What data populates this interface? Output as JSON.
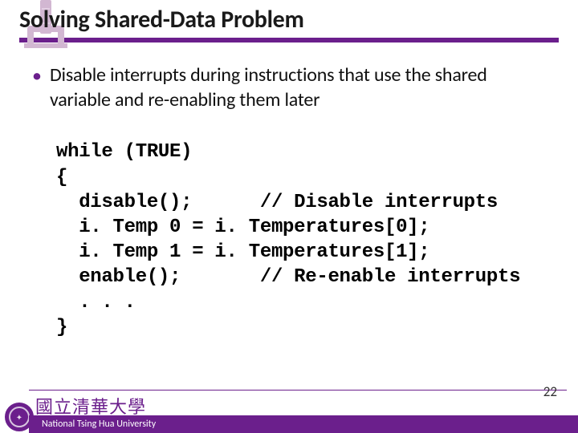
{
  "header": {
    "title": "Solving Shared-Data Problem"
  },
  "content": {
    "bullet_symbol": "•",
    "bullet_text": "Disable interrupts during instructions that use the shared variable and re-enabling them later",
    "code": "while (TRUE)\n{\n  disable();      // Disable interrupts\n  i. Temp 0 = i. Temperatures[0];\n  i. Temp 1 = i. Temperatures[1];\n  enable();       // Re-enable interrupts\n  . . .\n}"
  },
  "footer": {
    "logo_cn": "國立清華大學",
    "university": "National Tsing Hua University",
    "page_number": "22"
  }
}
